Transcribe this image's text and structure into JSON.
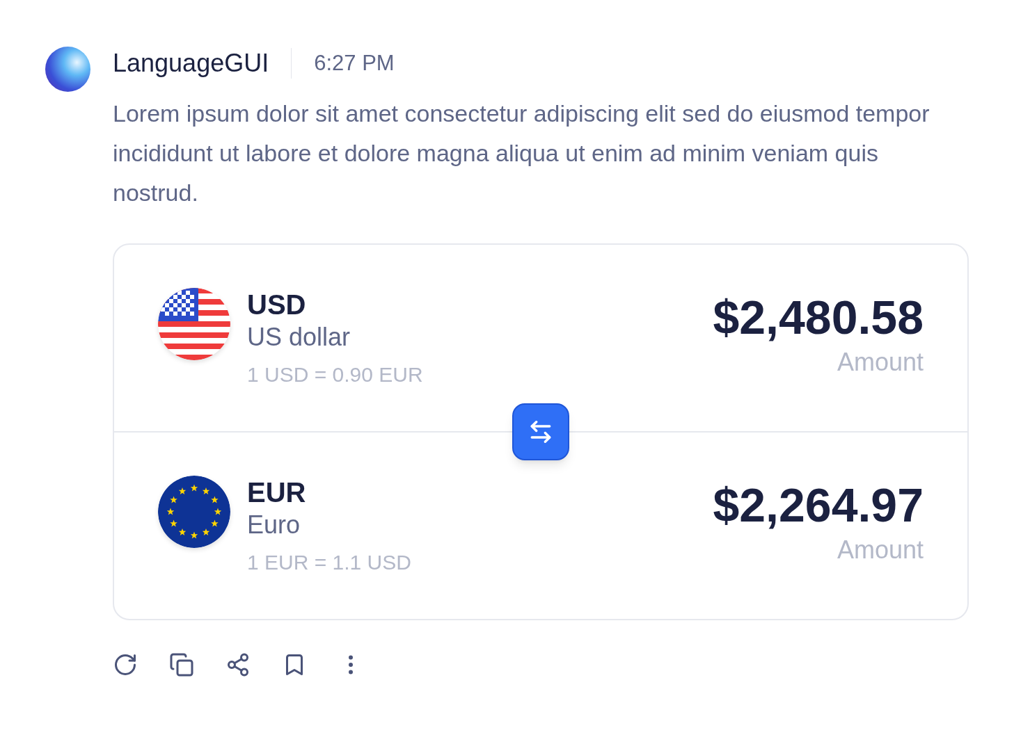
{
  "message": {
    "author": "LanguageGUI",
    "time": "6:27 PM",
    "text": "Lorem ipsum dolor sit amet consectetur adipiscing elit sed do eiusmod tempor incididunt ut labore et dolore magna aliqua ut enim ad minim veniam quis nostrud."
  },
  "converter": {
    "rows": [
      {
        "kind": "us",
        "code": "USD",
        "name": "US dollar",
        "rate": "1 USD = 0.90 EUR",
        "amount": "$2,480.58",
        "amount_label": "Amount"
      },
      {
        "kind": "eu",
        "code": "EUR",
        "name": "Euro",
        "rate": "1 EUR = 1.1 USD",
        "amount": "$2,264.97",
        "amount_label": "Amount"
      }
    ]
  },
  "actions": [
    {
      "kind": "refresh"
    },
    {
      "kind": "copy"
    },
    {
      "kind": "share"
    },
    {
      "kind": "bookmark"
    },
    {
      "kind": "more"
    }
  ]
}
